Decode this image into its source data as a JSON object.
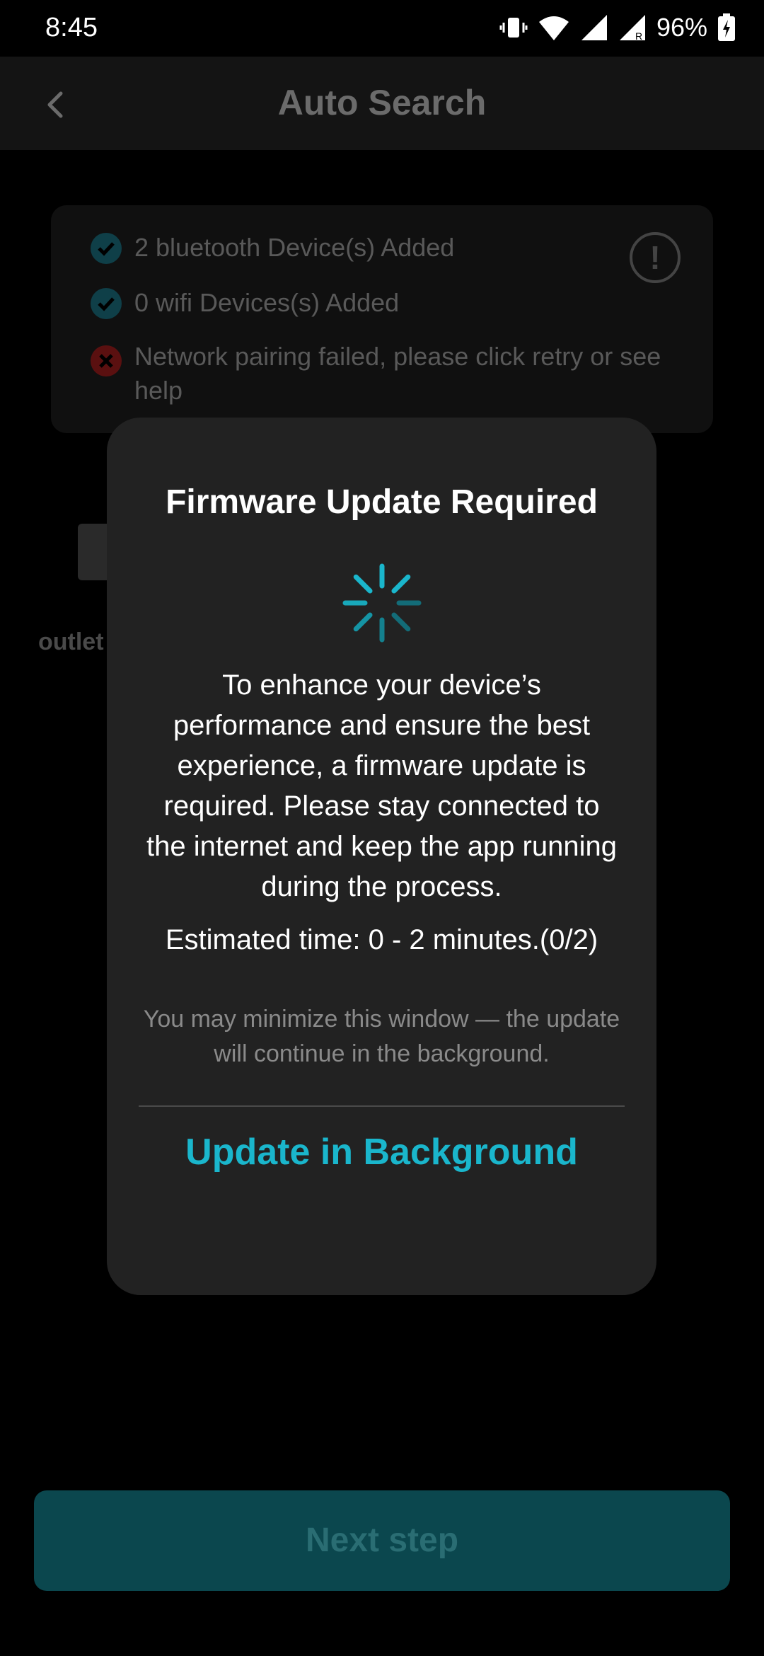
{
  "status": {
    "time": "8:45",
    "battery": "96%"
  },
  "header": {
    "title": "Auto Search"
  },
  "results": [
    {
      "status": "success",
      "text": "2 bluetooth Device(s) Added"
    },
    {
      "status": "success",
      "text": "0 wifi Devices(s) Added"
    },
    {
      "status": "error",
      "text": "Network pairing failed, please click retry or see help"
    }
  ],
  "device": {
    "label": "outlet"
  },
  "modal": {
    "title": "Firmware Update Required",
    "body": "To enhance your device’s performance and ensure the best experience, a firmware update is required. Please stay connected to the internet and keep the app running during the process.",
    "eta": "Estimated time: 0 - 2 minutes.(0/2)",
    "note": "You may minimize this window — the update will continue in the background.",
    "button": "Update in Background"
  },
  "footer": {
    "next_label": "Next step"
  },
  "colors": {
    "accent": "#1ab6cc",
    "next_button_bg": "#0b474e",
    "modal_bg": "#222222"
  }
}
